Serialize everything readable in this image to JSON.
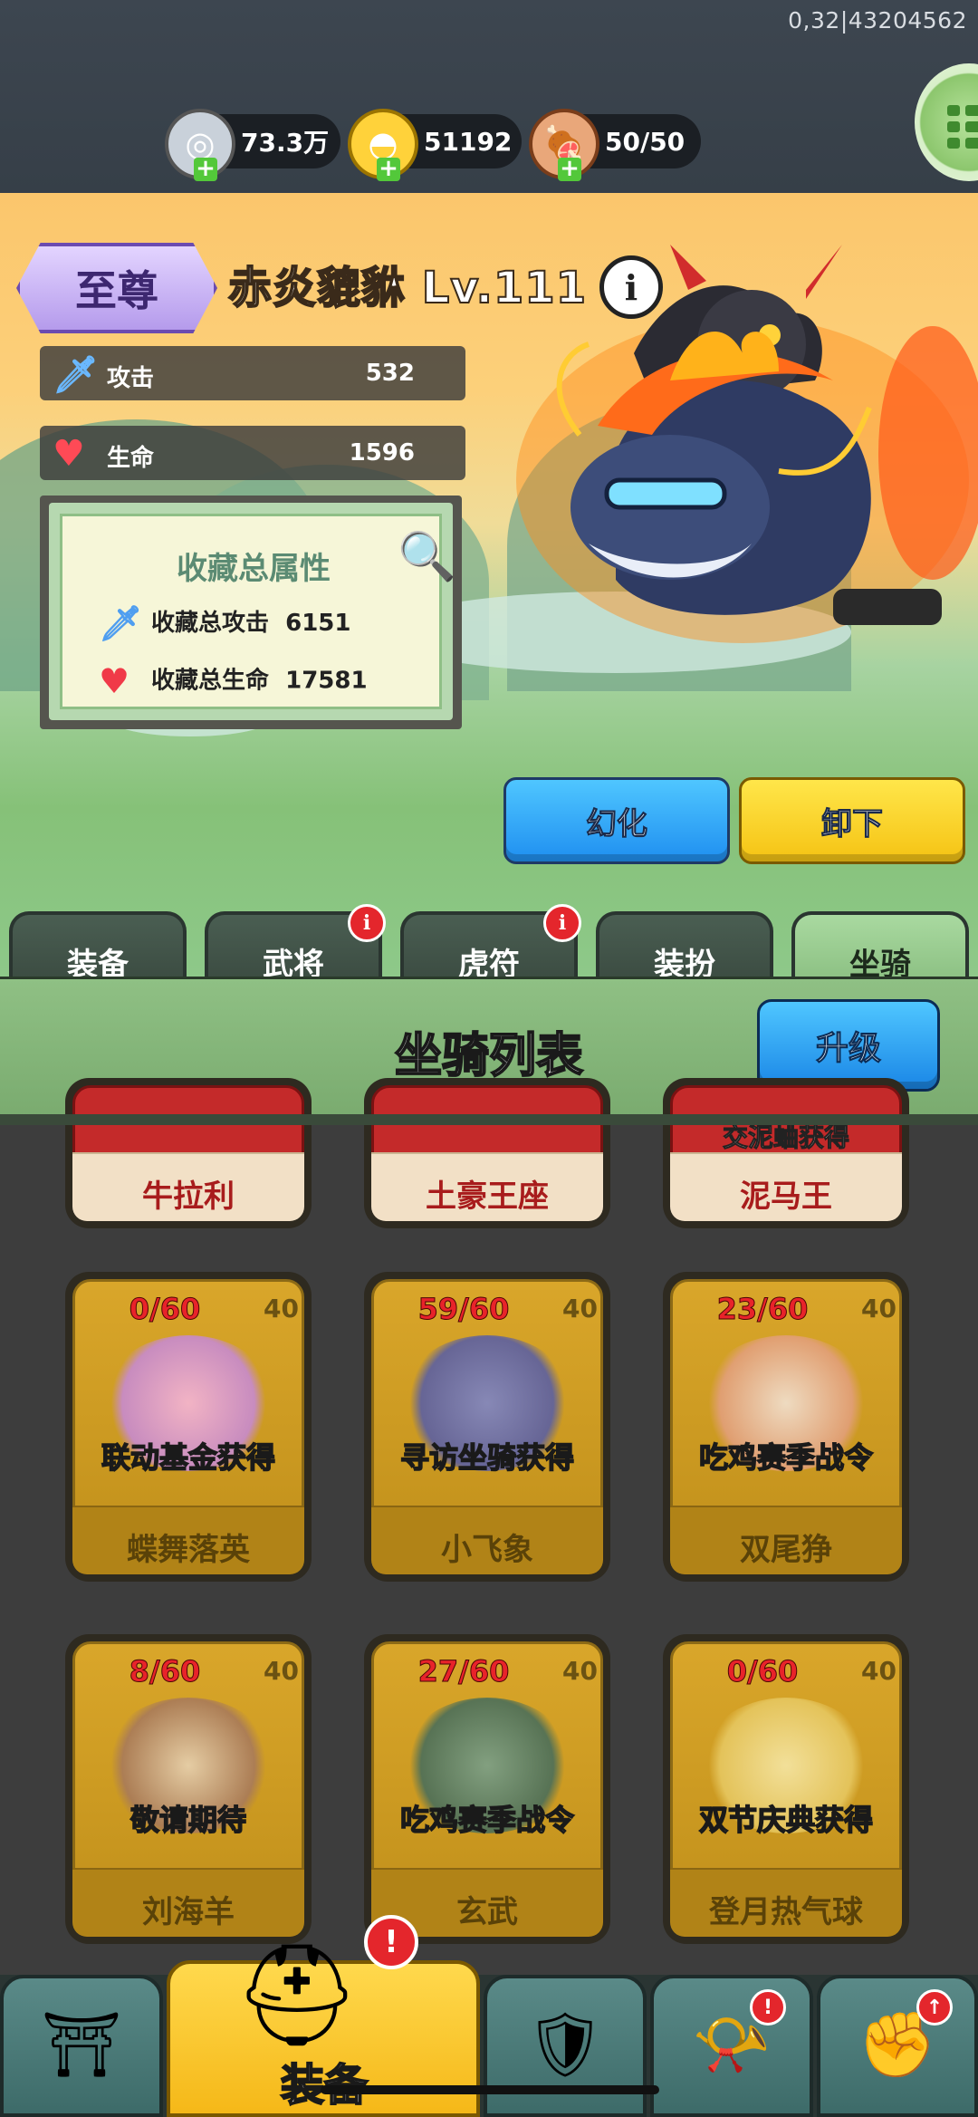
{
  "debug_text": "0,32|43204562",
  "resources": [
    {
      "name": "silver",
      "icon": "silver-coin-icon",
      "value": "73.3万"
    },
    {
      "name": "gold",
      "icon": "gold-ingot-icon",
      "value": "51192"
    },
    {
      "name": "stamina",
      "icon": "meat-icon",
      "value": "50/50"
    }
  ],
  "mount": {
    "rank": "至尊",
    "name": "赤炎貔貅 Lv.111",
    "stats": [
      {
        "label": "攻击",
        "value": "532"
      },
      {
        "label": "生命",
        "value": "1596"
      }
    ],
    "collection": {
      "title": "收藏总属性",
      "attack_label": "收藏总攻击",
      "attack_value": "6151",
      "hp_label": "收藏总生命",
      "hp_value": "17581"
    },
    "buttons": {
      "transform": "幻化",
      "unequip": "卸下"
    }
  },
  "tabs": [
    {
      "label": "装备",
      "badge": false
    },
    {
      "label": "武将",
      "badge": true
    },
    {
      "label": "虎符",
      "badge": true
    },
    {
      "label": "装扮",
      "badge": false
    },
    {
      "label": "坐骑",
      "badge": false,
      "active": true
    }
  ],
  "list": {
    "title": "坐骑列表",
    "upgrade_label": "升级",
    "partial_row": [
      "牛拉利",
      "土豪王座",
      "泥马王"
    ],
    "partial_row_source_3": "交泥蛐获得",
    "cards": [
      {
        "progress": "0/60",
        "level": "40",
        "source": "联动基金获得",
        "name": "蝶舞落英"
      },
      {
        "progress": "59/60",
        "level": "40",
        "source": "寻访坐骑获得",
        "name": "小飞象"
      },
      {
        "progress": "23/60",
        "level": "40",
        "source": "吃鸡赛季战令",
        "name": "双尾狰"
      },
      {
        "progress": "8/60",
        "level": "40",
        "source": "敬请期待",
        "name": "刘海羊"
      },
      {
        "progress": "27/60",
        "level": "40",
        "source": "吃鸡赛季战令",
        "name": "玄武"
      },
      {
        "progress": "0/60",
        "level": "40",
        "source": "双节庆典获得",
        "name": "登月热气球"
      }
    ]
  },
  "bottom_nav": {
    "active_label": "装备",
    "alert": "!"
  },
  "colors": {
    "accent_blue": "#1f8ff0",
    "accent_yellow": "#f5c313",
    "alert_red": "#e4262c"
  }
}
